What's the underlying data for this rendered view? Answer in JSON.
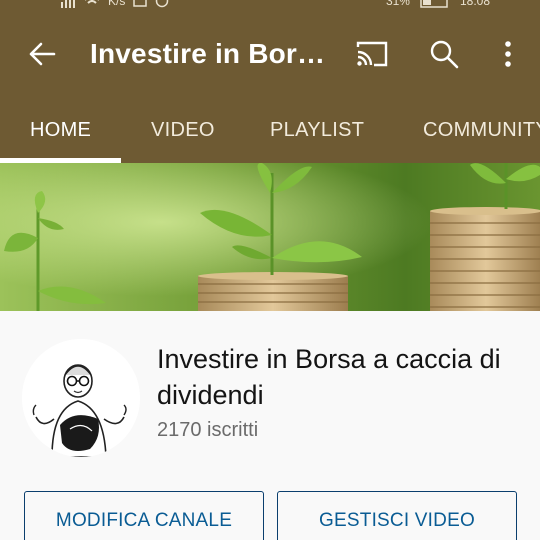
{
  "status_bar": {
    "speed": "K/s",
    "battery": "31%",
    "time": "18:08"
  },
  "app_bar": {
    "title": "Investire in Borsa a caccia di dividendi",
    "icons": [
      "back-arrow-icon",
      "cast-icon",
      "search-icon",
      "more-vert-icon"
    ]
  },
  "tabs": [
    {
      "label": "HOME",
      "active": true
    },
    {
      "label": "VIDEO",
      "active": false
    },
    {
      "label": "PLAYLIST",
      "active": false
    },
    {
      "label": "COMMUNITY",
      "active": false
    }
  ],
  "channel": {
    "name": "Investire in Borsa a caccia di dividendi",
    "subscribers": "2170 iscritti"
  },
  "actions": {
    "edit_label": "MODIFICA CANALE",
    "manage_label": "GESTISCI VIDEO"
  },
  "colors": {
    "header": "#6e5a33",
    "button_text": "#0a5c94"
  }
}
